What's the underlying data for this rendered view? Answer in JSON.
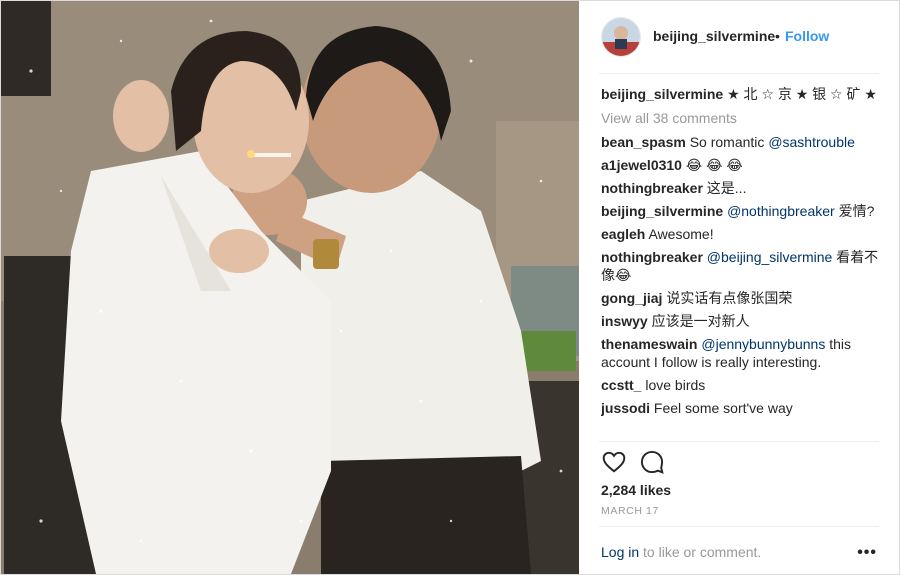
{
  "header": {
    "username": "beijing_silvermine",
    "separator": "•",
    "follow_label": "Follow"
  },
  "caption": {
    "username": "beijing_silvermine",
    "text": "★ 北 ☆ 京 ★ 银 ☆ 矿 ★"
  },
  "view_all_label": "View all 38 comments",
  "comments": [
    {
      "user": "bean_spasm",
      "text": "So romantic ",
      "mention": "@sashtrouble",
      "after": ""
    },
    {
      "user": "a1jewel0310",
      "text": "😂 😂 😂",
      "mention": "",
      "after": ""
    },
    {
      "user": "nothingbreaker",
      "text": "这是...",
      "mention": "",
      "after": ""
    },
    {
      "user": "beijing_silvermine",
      "text": "",
      "mention": "@nothingbreaker",
      "after": " 爱情?"
    },
    {
      "user": "eagleh",
      "text": "Awesome!",
      "mention": "",
      "after": ""
    },
    {
      "user": "nothingbreaker",
      "text": "",
      "mention": "@beijing_silvermine",
      "after": " 看着不像😂"
    },
    {
      "user": "gong_jiaj",
      "text": "说实话有点像张国荣",
      "mention": "",
      "after": ""
    },
    {
      "user": "inswyy",
      "text": "应该是一对新人",
      "mention": "",
      "after": ""
    },
    {
      "user": "thenameswain",
      "text": "",
      "mention": "@jennybunnybunns",
      "after": " this account I follow is really interesting."
    },
    {
      "user": "ccstt_",
      "text": "love birds",
      "mention": "",
      "after": ""
    },
    {
      "user": "jussodi",
      "text": "Feel some sort've way",
      "mention": "",
      "after": ""
    }
  ],
  "icons": {
    "like": "heart-icon",
    "comment": "comment-bubble-icon",
    "more": "more-options-icon"
  },
  "likes_label": "2,284 likes",
  "date_label": "MARCH 17",
  "login": {
    "link": "Log in",
    "rest": " to like or comment."
  },
  "more_label": "•••",
  "colors": {
    "link_blue": "#3897f0",
    "mention_blue": "#003569",
    "muted_gray": "#999999"
  }
}
